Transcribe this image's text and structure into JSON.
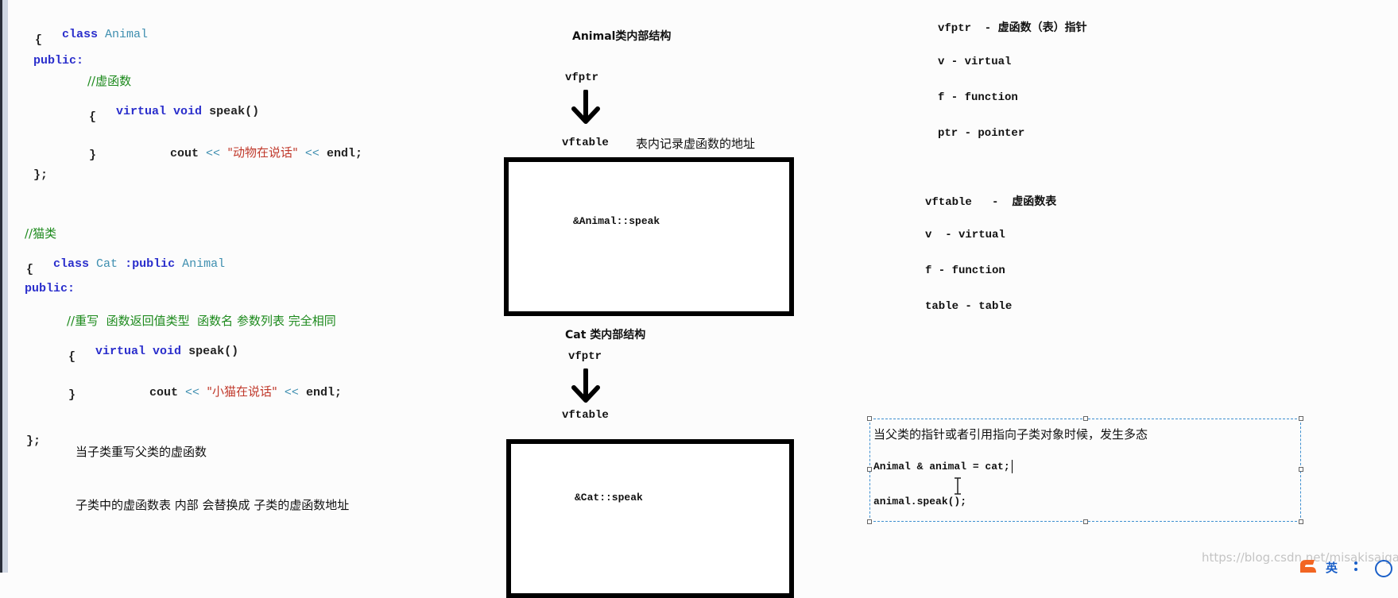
{
  "code": {
    "animal_class": {
      "line1": {
        "keyword": "class",
        "name": "Animal"
      },
      "open_brace": "{",
      "access": "public:",
      "comment": "//虚函数",
      "method": {
        "kw1": "virtual",
        "kw2": "void",
        "name": "speak()"
      },
      "method_open": "{",
      "cout": {
        "stream": "cout",
        "op1": "<<",
        "string": "\"动物在说话\"",
        "op2": "<<",
        "end": "endl;"
      },
      "method_close": "}",
      "close": "};"
    },
    "cat_class": {
      "comment_top": "//猫类",
      "line1": {
        "keyword": "class",
        "name": "Cat",
        "inherit_kw": ":public",
        "base": "Animal"
      },
      "open_brace": "{",
      "access": "public:",
      "comment": "//重写  函数返回值类型  函数名 参数列表 完全相同",
      "method": {
        "kw1": "virtual",
        "kw2": "void",
        "name": "speak()"
      },
      "method_open": "{",
      "cout": {
        "stream": "cout",
        "op1": "<<",
        "string": "\"小猫在说话\"",
        "op2": "<<",
        "end": "endl;"
      },
      "method_close": "}",
      "close": "};"
    }
  },
  "notes_left": {
    "override_note": "当子类重写父类的虚函数",
    "replace_note": "子类中的虚函数表 内部 会替换成 子类的虚函数地址"
  },
  "diagram": {
    "animal": {
      "title": "Animal类内部结构",
      "vfptr": "vfptr",
      "vftable": "vftable",
      "table_note": "表内记录虚函数的地址",
      "entry": "&Animal::speak"
    },
    "cat": {
      "title": "Cat 类内部结构",
      "vfptr": "vfptr",
      "vftable": "vftable",
      "entry": "&Cat::speak"
    }
  },
  "glossary": {
    "vfptr": {
      "heading": "vfptr  - 虚函数（表）指针",
      "items": [
        "v - virtual",
        "f - function",
        "ptr - pointer"
      ]
    },
    "vftable": {
      "heading": "vftable   -  虚函数表",
      "items": [
        "v  - virtual",
        "f - function",
        "table - table"
      ]
    }
  },
  "polymorphism_textbox": {
    "line1": "当父类的指针或者引用指向子类对象时候，发生多态",
    "line2": "Animal & animal = cat;",
    "line3": "animal.speak();"
  },
  "watermark": "https://blog.csdn.net/misakisaigao",
  "ime": {
    "label": "英"
  }
}
